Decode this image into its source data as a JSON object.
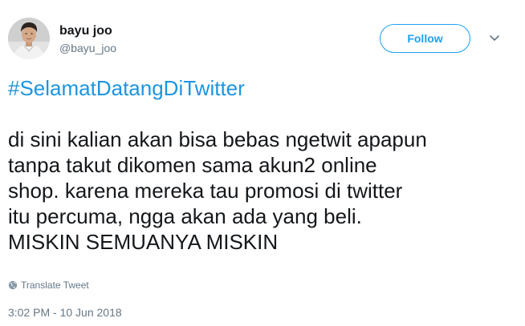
{
  "author": {
    "display_name": "bayu joo",
    "handle": "@bayu_joo"
  },
  "follow_button": {
    "label": "Follow"
  },
  "menu": {
    "icon": "chevron-down-icon"
  },
  "tweet": {
    "hashtag": "#SelamatDatangDiTwitter",
    "lines": [
      "di sini kalian akan bisa bebas ngetwit apapun",
      "tanpa takut dikomen sama akun2 online",
      "shop. karena mereka tau promosi di twitter",
      "itu percuma, ngga akan ada yang beli.",
      "MISKIN SEMUANYA MISKIN"
    ]
  },
  "translate": {
    "label": "Translate Tweet",
    "icon": "globe-icon"
  },
  "timestamp": "3:02 PM - 10 Jun 2018",
  "colors": {
    "accent": "#1da1f2",
    "hashtag": "#1b95e0",
    "text": "#14171a",
    "secondary": "#657786"
  }
}
